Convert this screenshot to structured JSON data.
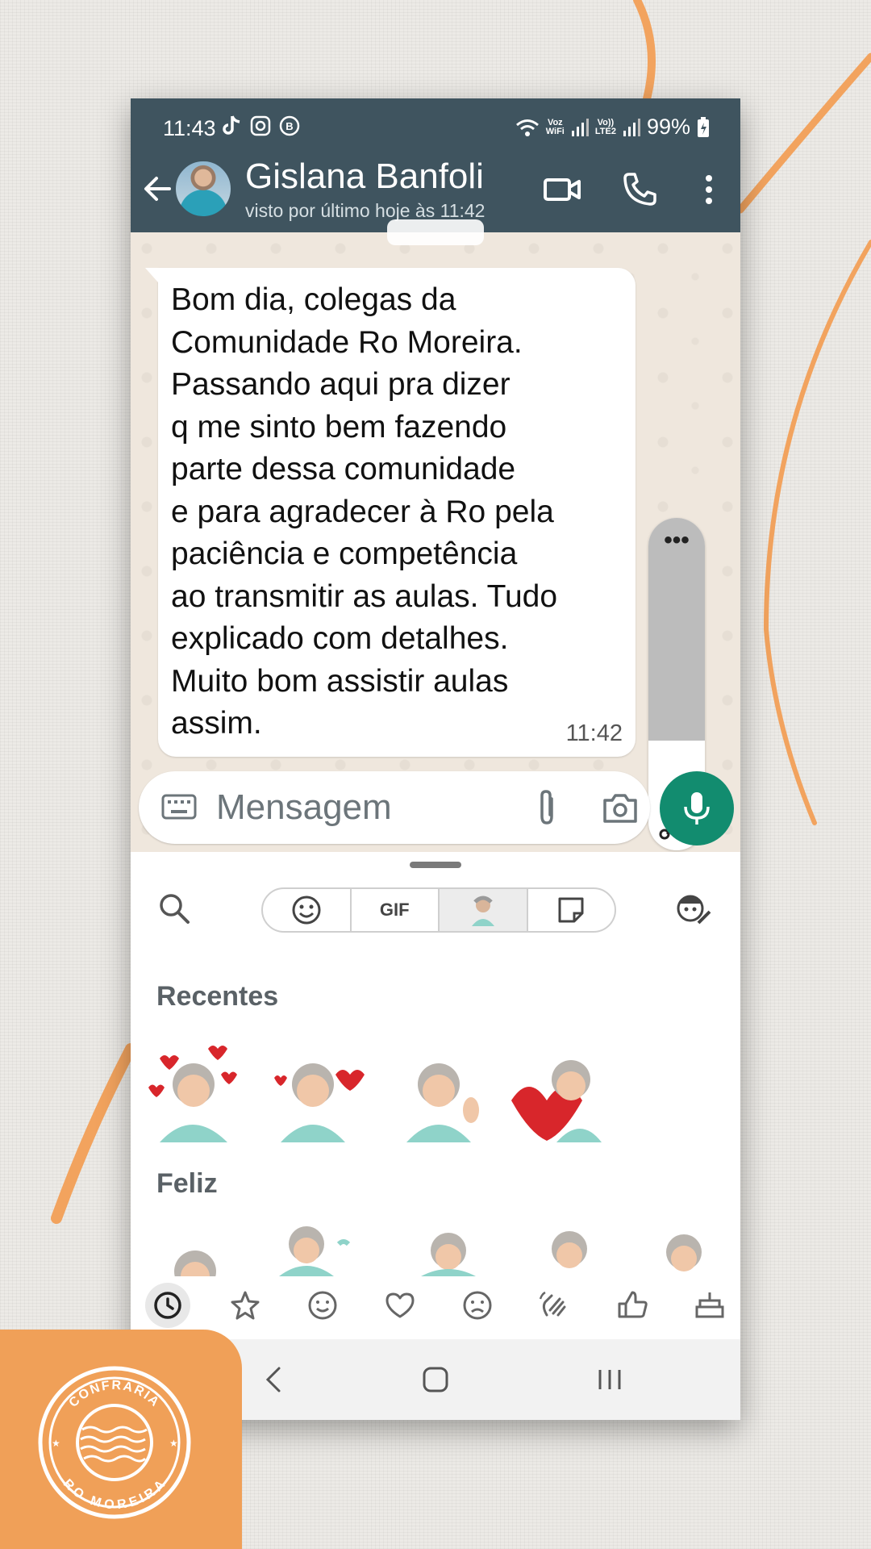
{
  "status_bar": {
    "time": "11:43",
    "voz_wifi": "Voz\nWiFi",
    "volte": "Vo))\nLTE2",
    "battery": "99%"
  },
  "contact": {
    "name": "Gislana Banfoli",
    "last_seen": "visto por último hoje às 11:42"
  },
  "chat": {
    "message_text": "Bom dia, colegas da\nComunidade Ro Moreira.\nPassando aqui pra dizer\nq me sinto bem fazendo\nparte dessa comunidade\ne para agradecer à Ro pela\npaciência e competência\nao transmitir as aulas. Tudo\nexplicado com detalhes.\nMuito bom assistir aulas\nassim.",
    "message_time": "11:42",
    "scroll_dots": "•••"
  },
  "composer": {
    "placeholder": "Mensagem"
  },
  "sticker_panel": {
    "tabs": [
      "emoji-icon",
      "GIF",
      "avatar-icon",
      "sticker-icon"
    ],
    "gif_label": "GIF",
    "section_recent": "Recentes",
    "section_happy": "Feliz",
    "categories": [
      "clock-icon",
      "star-icon",
      "smile-icon",
      "heart-icon",
      "sad-icon",
      "wave-icon",
      "thumbs-up-icon",
      "cake-icon"
    ]
  },
  "badge": {
    "top_text": "CONFRARIA",
    "bottom_text": "RO MOREIRA"
  },
  "colors": {
    "header": "#3f545f",
    "mic_button": "#128c6f",
    "brand_orange": "#f0a058"
  }
}
